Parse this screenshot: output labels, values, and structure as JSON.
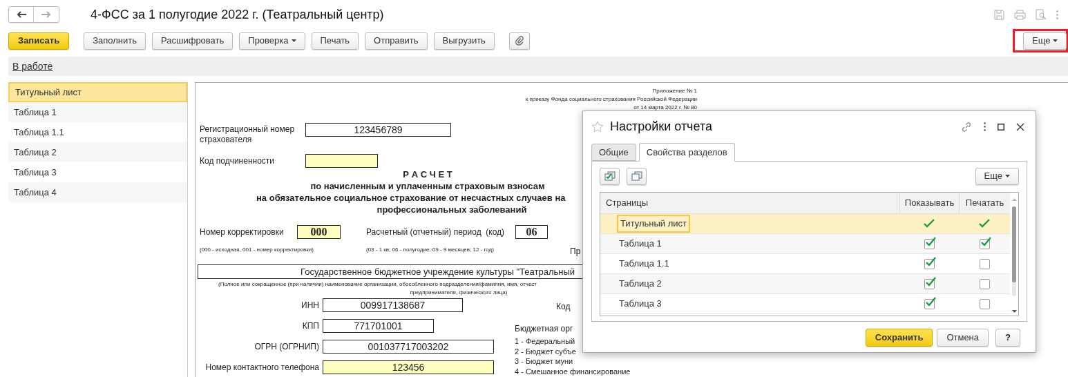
{
  "window": {
    "title": "4-ФСС за 1 полугодие 2022 г. (Театральный центр)"
  },
  "toolbar": {
    "buttons": [
      {
        "label": "Записать",
        "kind": "primary"
      },
      {
        "label": "Заполнить",
        "kind": "plain"
      },
      {
        "label": "Расшифровать",
        "kind": "plain"
      },
      {
        "label": "Проверка",
        "kind": "dropdown"
      },
      {
        "label": "Печать",
        "kind": "plain"
      },
      {
        "label": "Отправить",
        "kind": "plain"
      },
      {
        "label": "Выгрузить",
        "kind": "plain"
      }
    ],
    "more": "Еще"
  },
  "status_link": "В работе",
  "sidebar": {
    "items": [
      {
        "label": "Титульный лист",
        "selected": true
      },
      {
        "label": "Таблица 1",
        "selected": false
      },
      {
        "label": "Таблица 1.1",
        "selected": false
      },
      {
        "label": "Таблица 2",
        "selected": false
      },
      {
        "label": "Таблица 3",
        "selected": false
      },
      {
        "label": "Таблица 4",
        "selected": false
      }
    ]
  },
  "document": {
    "appendix": [
      "Приложение № 1",
      "к приказу Фонда социального страхования Российской Федерации",
      "от 14 марта 2022 г. № 80"
    ],
    "reg_number": {
      "label": "Регистрационный номер страхователя",
      "value": "123456789",
      "highlighted": false
    },
    "subordination_code": {
      "label": "Код подчиненности",
      "highlighted": true
    },
    "heading": "Р А С Ч Е Т",
    "subheading": [
      "по начисленным и уплаченным страховым взносам",
      "на обязательное социальное страхование от несчастных случаев на",
      "профессиональных заболеваний"
    ],
    "correction": {
      "label": "Номер корректировки",
      "value": "000",
      "highlighted": true,
      "note": "(000 - исходная, 001 - номер корректировки)"
    },
    "period": {
      "label": "Расчетный (отчетный) период  (код)",
      "value": "06",
      "highlighted": false,
      "note": "(03 - 1 кв; 06 - полугодие; 09 - 9 месяцев; 12 - год)"
    },
    "period_right": "Пр",
    "organization": {
      "value": "Государственное бюджетное учреждение культуры \"Театральный",
      "note": [
        "(Полное или сокращенное (при наличии) наименование организации, обособленного подразделения/фамилия, имя, отчест",
        "предпринимателя, физического лица)"
      ]
    },
    "ids": [
      {
        "label": "ИНН",
        "value": "009917138687",
        "highlighted": false
      },
      {
        "label": "КПП",
        "value": "771701001",
        "highlighted": false
      },
      {
        "label": "ОГРН (ОГРНИП)",
        "value": "001037717003202",
        "highlighted": false
      },
      {
        "label": "Номер контактного телефона",
        "value": "123456",
        "highlighted": true
      }
    ],
    "code_label": "Код",
    "budget": {
      "label": "Бюджетная орг",
      "options": [
        "1 - Федеральный",
        "2 - Бюджет субъе",
        "3 - Бюджет муни",
        "4 - Смешанное финансирование"
      ]
    }
  },
  "dialog": {
    "title": "Настройки отчета",
    "tabs": [
      {
        "label": "Общие",
        "selected": false
      },
      {
        "label": "Свойства разделов",
        "selected": true
      }
    ],
    "more": "Еще",
    "columns": [
      "Страницы",
      "Показывать",
      "Печатать"
    ],
    "rows": [
      {
        "name": "Титульный лист",
        "show": true,
        "print": true,
        "selected": true
      },
      {
        "name": "Таблица 1",
        "show": true,
        "print": true,
        "selected": false
      },
      {
        "name": "Таблица 1.1",
        "show": true,
        "print": false,
        "selected": false
      },
      {
        "name": "Таблица 2",
        "show": true,
        "print": false,
        "selected": false
      },
      {
        "name": "Таблица 3",
        "show": true,
        "print": false,
        "selected": false
      }
    ],
    "buttons": [
      {
        "label": "Сохранить",
        "kind": "primary"
      },
      {
        "label": "Отмена",
        "kind": "plain"
      },
      {
        "label": "?",
        "kind": "help"
      }
    ]
  }
}
